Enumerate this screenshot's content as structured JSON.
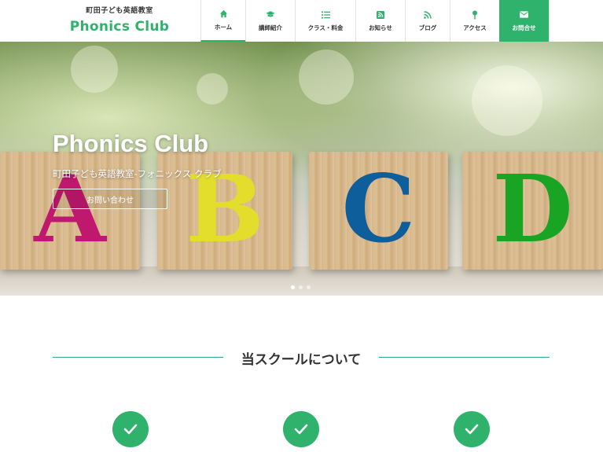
{
  "brand": {
    "subtitle": "町田子ども英語教室",
    "title": "Phonics Club",
    "color": "#2fb36c"
  },
  "nav": {
    "items": [
      {
        "label": "ホーム",
        "icon": "home-icon"
      },
      {
        "label": "講師紹介",
        "icon": "graduation-cap-icon"
      },
      {
        "label": "クラス・料金",
        "icon": "list-icon"
      },
      {
        "label": "お知らせ",
        "icon": "rss-square-icon"
      },
      {
        "label": "ブログ",
        "icon": "rss-icon"
      },
      {
        "label": "アクセス",
        "icon": "map-pin-icon"
      },
      {
        "label": "お問合せ",
        "icon": "envelope-icon"
      }
    ]
  },
  "hero": {
    "title": "Phonics Club",
    "subtitle": "町田子ども英語教室-フォニックス クラブ",
    "button": "お問い合わせ",
    "blocks": [
      {
        "letter": "A",
        "color": "#c0186e"
      },
      {
        "letter": "B",
        "color": "#e3de2c"
      },
      {
        "letter": "C",
        "color": "#0d5e9a"
      },
      {
        "letter": "D",
        "color": "#1aa424"
      }
    ],
    "slides": 3,
    "active_slide": 1
  },
  "about": {
    "title": "当スクールについて",
    "features": [
      "check-icon",
      "check-icon",
      "check-icon"
    ]
  }
}
